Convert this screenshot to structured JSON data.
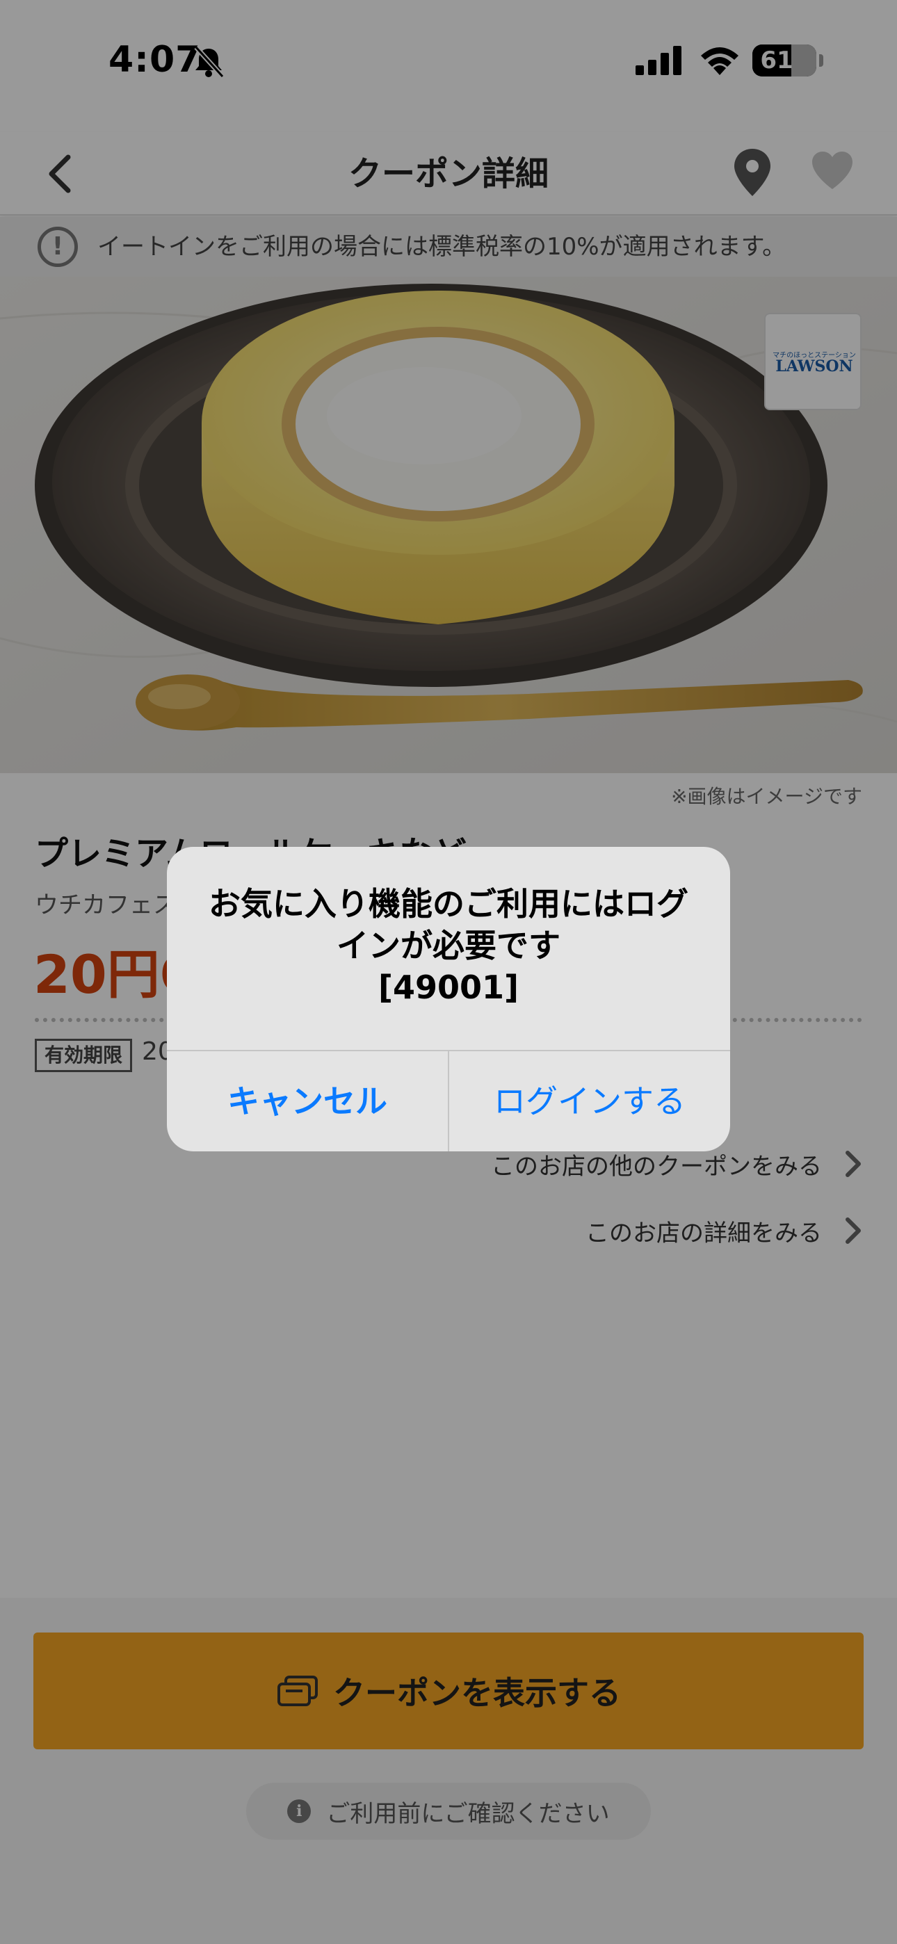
{
  "status_bar": {
    "time": "4:07",
    "battery": "61",
    "battery_level": 0.61
  },
  "nav": {
    "title": "クーポン詳細"
  },
  "notice": {
    "text": "イートインをご利用の場合には標準税率の10%が適用されます。"
  },
  "hero": {
    "logo_sub": "マチのほっとステーション",
    "logo": "LAWSON",
    "image_note": "※画像はイメージです"
  },
  "coupon": {
    "title": "プレミアムロールケーキなど",
    "shop": "ウチカフェス",
    "price": "20円O",
    "validity_label": "有効期限",
    "validity_value": "20"
  },
  "links": {
    "other_coupons": "このお店の他のクーポンをみる",
    "shop_detail": "このお店の詳細をみる"
  },
  "bottom": {
    "show_coupon": "クーポンを表示する",
    "confirm": "ご利用前にご確認ください"
  },
  "alert": {
    "message": "お気に入り機能のご利用にはログインが必要です",
    "code": "[49001]",
    "cancel": "キャンセル",
    "login": "ログインする"
  },
  "colors": {
    "accent": "#f5a623",
    "price": "#d2430f",
    "link_blue": "#0a7aff"
  }
}
